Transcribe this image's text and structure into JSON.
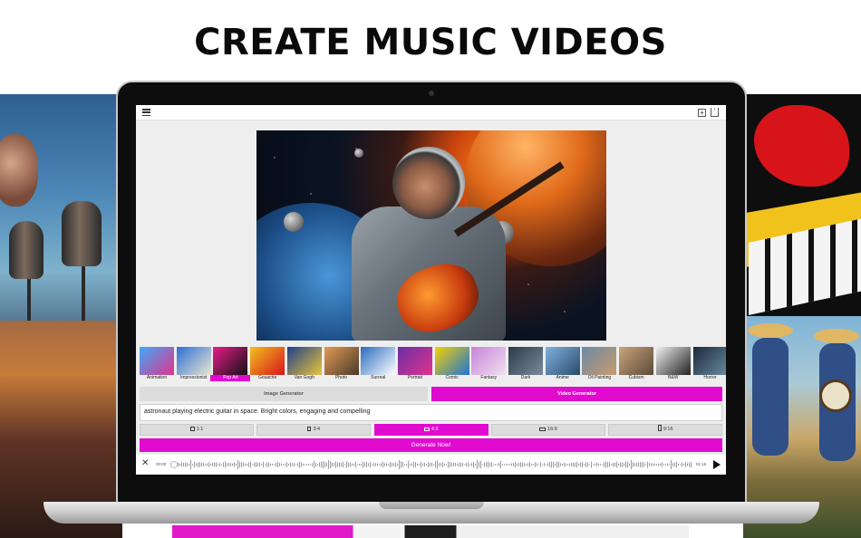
{
  "headline": "CREATE MUSIC VIDEOS",
  "app": {
    "icons": {
      "menu": "menu-icon",
      "add": "add-icon",
      "share": "share-icon",
      "close": "close-icon",
      "play": "play-icon"
    },
    "preview_image": "astronaut playing electric guitar in space",
    "styles": [
      {
        "label": "Animation",
        "selected": false,
        "colors": [
          "#3fa9f5",
          "#e0338f"
        ]
      },
      {
        "label": "Impressionist",
        "selected": false,
        "colors": [
          "#2e6fd6",
          "#e8e6d0"
        ]
      },
      {
        "label": "Pop Art",
        "selected": true,
        "colors": [
          "#e81b8a",
          "#111111"
        ]
      },
      {
        "label": "Gouache",
        "selected": false,
        "colors": [
          "#f2c21c",
          "#d8141b"
        ]
      },
      {
        "label": "Van Gogh",
        "selected": false,
        "colors": [
          "#1f3f8a",
          "#e9c43a"
        ]
      },
      {
        "label": "Photo",
        "selected": false,
        "colors": [
          "#e39a55",
          "#4a3a2a"
        ]
      },
      {
        "label": "Surreal",
        "selected": false,
        "colors": [
          "#2a6cc0",
          "#ffffff"
        ]
      },
      {
        "label": "Portrait",
        "selected": false,
        "colors": [
          "#6a2ea3",
          "#e0338f"
        ]
      },
      {
        "label": "Comic",
        "selected": false,
        "colors": [
          "#f5d200",
          "#1e73d8"
        ]
      },
      {
        "label": "Fantasy",
        "selected": false,
        "colors": [
          "#c783d8",
          "#f0e0f0"
        ]
      },
      {
        "label": "Dark",
        "selected": false,
        "colors": [
          "#2b3a4a",
          "#7a8a9a"
        ]
      },
      {
        "label": "Anime",
        "selected": false,
        "colors": [
          "#7fb2e0",
          "#2a4a6a"
        ]
      },
      {
        "label": "Oil Painting",
        "selected": false,
        "colors": [
          "#6a8aa8",
          "#c99a6a"
        ]
      },
      {
        "label": "Cubism",
        "selected": false,
        "colors": [
          "#caa57a",
          "#5a4a3a"
        ]
      },
      {
        "label": "B&W",
        "selected": false,
        "colors": [
          "#f0f0f0",
          "#222222"
        ]
      },
      {
        "label": "Horror",
        "selected": false,
        "colors": [
          "#1a2a3a",
          "#6a8aa0"
        ]
      }
    ],
    "modes": {
      "image": "Image Generator",
      "video": "Video Generator",
      "active": "video"
    },
    "prompt": "astronaut playing electric guitar in space. Bright colors, engaging and compelling",
    "ratios": [
      {
        "label": "1:1",
        "selected": false
      },
      {
        "label": "3:4",
        "selected": false
      },
      {
        "label": "4:3",
        "selected": true
      },
      {
        "label": "16:9",
        "selected": false
      },
      {
        "label": "9:16",
        "selected": false
      }
    ],
    "generate_label": "Generate Now!",
    "player": {
      "time_start": "00:00",
      "time_end": "01:16",
      "progress": 0.0
    },
    "accent_color": "#e10bd0"
  }
}
